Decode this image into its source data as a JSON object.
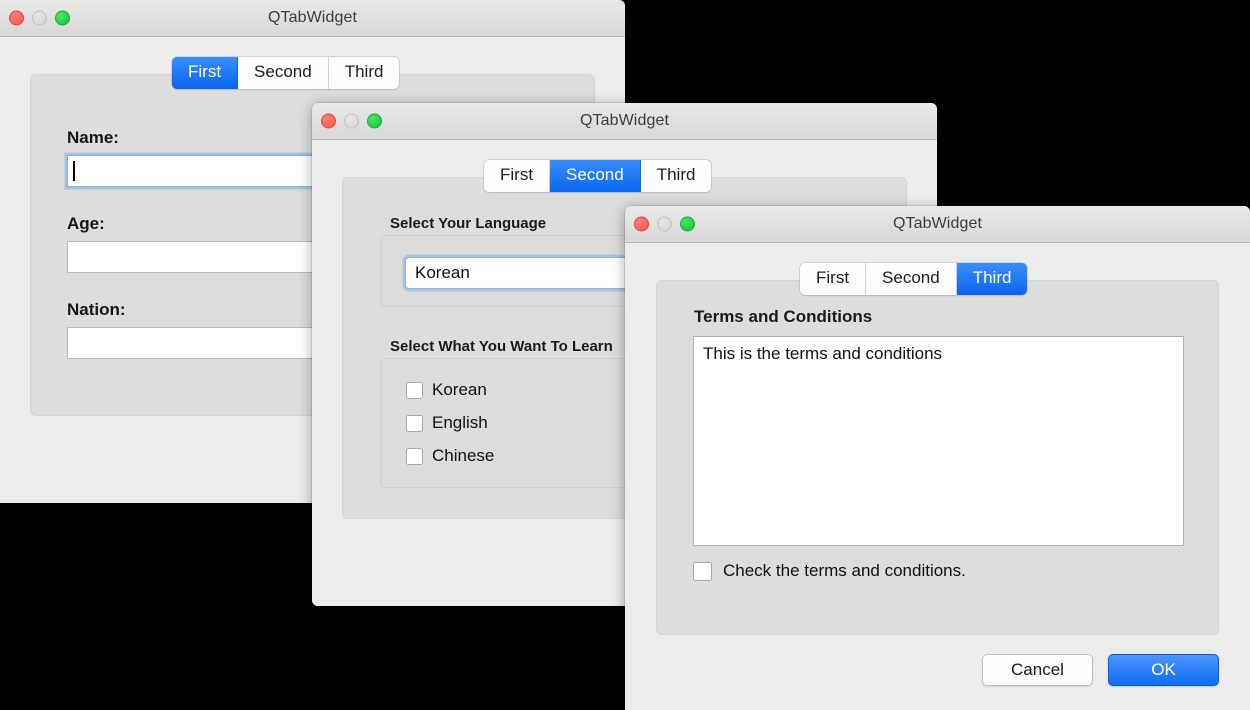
{
  "windows": [
    {
      "title": "QTabWidget",
      "traffic": [
        "close-button",
        "minimize-button",
        "zoom-button"
      ],
      "tabs": [
        {
          "label": "First",
          "active": true
        },
        {
          "label": "Second",
          "active": false
        },
        {
          "label": "Third",
          "active": false
        }
      ],
      "form": {
        "name_label": "Name:",
        "name_value": "",
        "age_label": "Age:",
        "age_value": "",
        "nation_label": "Nation:",
        "nation_value": ""
      }
    },
    {
      "title": "QTabWidget",
      "traffic": [
        "close-button",
        "minimize-button",
        "zoom-button"
      ],
      "tabs": [
        {
          "label": "First",
          "active": false
        },
        {
          "label": "Second",
          "active": true
        },
        {
          "label": "Third",
          "active": false
        }
      ],
      "language_group_label": "Select Your Language",
      "language_selected": "Korean",
      "learn_group_label": "Select What You Want To Learn",
      "learn_options": [
        {
          "label": "Korean",
          "checked": false
        },
        {
          "label": "English",
          "checked": false
        },
        {
          "label": "Chinese",
          "checked": false
        }
      ]
    },
    {
      "title": "QTabWidget",
      "traffic": [
        "close-button",
        "minimize-button",
        "zoom-button"
      ],
      "tabs": [
        {
          "label": "First",
          "active": false
        },
        {
          "label": "Second",
          "active": false
        },
        {
          "label": "Third",
          "active": true
        }
      ],
      "terms_label": "Terms and Conditions",
      "terms_text": "This is the terms and conditions",
      "agree_label": "Check the terms and conditions.",
      "agree_checked": false,
      "cancel_label": "Cancel",
      "ok_label": "OK"
    }
  ],
  "colors": {
    "accent_blue": "#0a66f0",
    "window_bg": "#ececec",
    "pane_bg": "#dddddd",
    "titlebar_top": "#e9e9e9",
    "titlebar_bottom": "#d8d8d8",
    "traffic_red": "#f8554a",
    "traffic_yellow": "#d4d4d4",
    "traffic_green": "#0fc22f",
    "desktop_bg": "#000000"
  }
}
